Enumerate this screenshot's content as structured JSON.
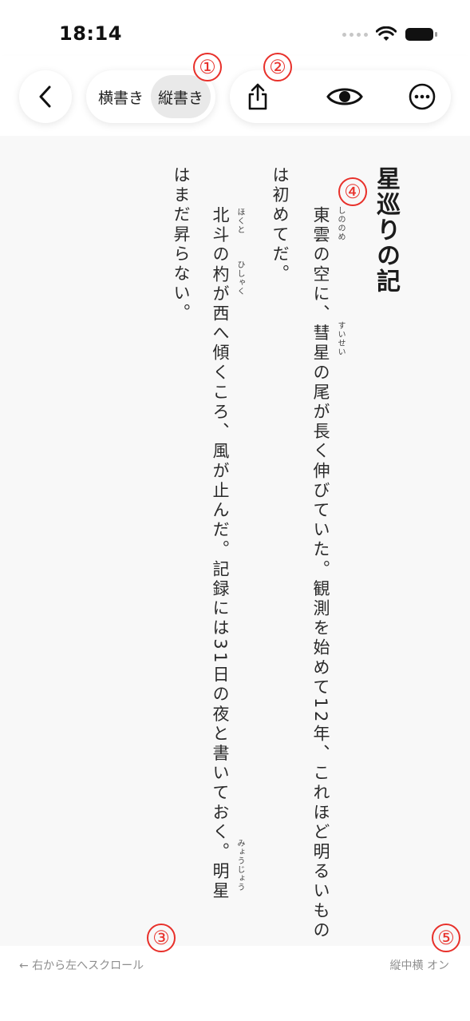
{
  "status_bar": {
    "time": "18:14"
  },
  "toolbar": {
    "back_icon": "chevron-left-icon",
    "segments": [
      {
        "label": "横書き",
        "selected": false
      },
      {
        "label": "縦書き",
        "selected": true
      }
    ],
    "share_icon": "share-icon",
    "view_icon": "eye-icon",
    "more_icon": "ellipsis-circle-icon"
  },
  "markers": [
    "①",
    "②",
    "③",
    "④",
    "⑤"
  ],
  "document": {
    "title": "星巡りの記",
    "columns": [
      "東雲の空に、彗星の尾が長く伸びていた。観測を始めて12年、これほど明るいもの",
      "は初めてだ。",
      "北斗の杓が西へ傾くころ、風が止んだ。記録には31日の夜と書いておく。明星",
      "はまだ昇らない。"
    ],
    "ruby": {
      "shinonome": "しののめ",
      "suisei": "すいせい",
      "hokuto": "ほくと",
      "hishaku": "ひしゃく",
      "myoujou": "みょうじょう"
    }
  },
  "footer": {
    "scroll_hint": "← 右から左へスクロール",
    "tcy_status": "縦中横 オン"
  },
  "colors": {
    "accent_marker": "#e8302a",
    "background": "#f8f8f8",
    "segment_selected": "#e9e9e9"
  }
}
